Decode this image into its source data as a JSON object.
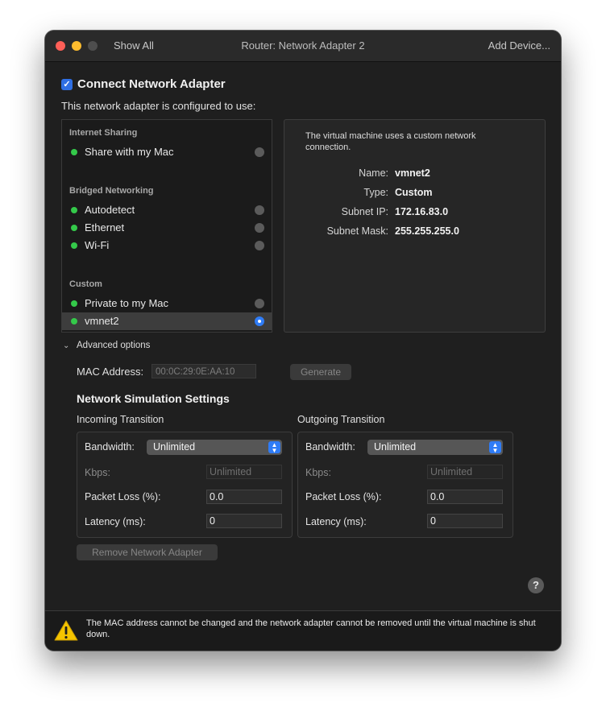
{
  "window": {
    "title": "Router: Network Adapter 2",
    "show_all": "Show All",
    "add_device": "Add Device..."
  },
  "connect": {
    "checked": true,
    "label": "Connect Network Adapter",
    "configured_text": "This network adapter is configured to use:"
  },
  "adapter_list": {
    "sections": [
      {
        "header": "Internet Sharing",
        "items": [
          {
            "label": "Share with my Mac",
            "selected": false
          }
        ]
      },
      {
        "header": "Bridged Networking",
        "items": [
          {
            "label": "Autodetect",
            "selected": false
          },
          {
            "label": "Ethernet",
            "selected": false
          },
          {
            "label": "Wi-Fi",
            "selected": false
          }
        ]
      },
      {
        "header": "Custom",
        "items": [
          {
            "label": "Private to my Mac",
            "selected": false
          },
          {
            "label": "vmnet2",
            "selected": true
          }
        ]
      }
    ],
    "status_color": "#34c94a"
  },
  "info_panel": {
    "description": "The virtual machine uses a custom network connection.",
    "fields": [
      {
        "key": "Name:",
        "value": "vmnet2"
      },
      {
        "key": "Type:",
        "value": "Custom"
      },
      {
        "key": "Subnet IP:",
        "value": "172.16.83.0"
      },
      {
        "key": "Subnet Mask:",
        "value": "255.255.255.0"
      }
    ]
  },
  "advanced": {
    "label": "Advanced options",
    "mac_label": "MAC Address:",
    "mac_value": "00:0C:29:0E:AA:10",
    "generate_label": "Generate"
  },
  "simulation": {
    "title": "Network Simulation Settings",
    "incoming": {
      "title": "Incoming Transition",
      "bandwidth_label": "Bandwidth:",
      "bandwidth_value": "Unlimited",
      "kbps_label": "Kbps:",
      "kbps_value": "Unlimited",
      "loss_label": "Packet Loss (%):",
      "loss_value": "0.0",
      "latency_label": "Latency (ms):",
      "latency_value": "0"
    },
    "outgoing": {
      "title": "Outgoing Transition",
      "bandwidth_label": "Bandwidth:",
      "bandwidth_value": "Unlimited",
      "kbps_label": "Kbps:",
      "kbps_value": "Unlimited",
      "loss_label": "Packet Loss (%):",
      "loss_value": "0.0",
      "latency_label": "Latency (ms):",
      "latency_value": "0"
    }
  },
  "remove_label": "Remove Network Adapter",
  "help_label": "?",
  "warning": {
    "icon": "warning-triangle-icon",
    "text": "The MAC address cannot be changed and the network adapter cannot be removed until the virtual machine is shut down."
  },
  "colors": {
    "accent": "#2f7cf6",
    "warning": "#f5c400"
  }
}
